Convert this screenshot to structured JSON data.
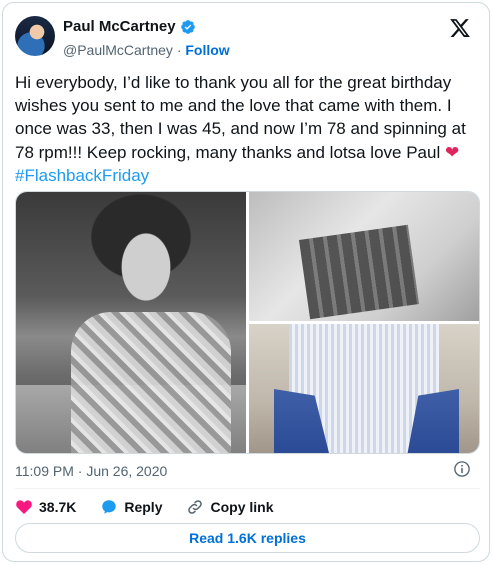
{
  "author": {
    "name": "Paul McCartney",
    "handle": "@PaulMcCartney",
    "separator": "·",
    "follow_label": "Follow"
  },
  "tweet": {
    "text_main": "Hi everybody, I’d like to thank you all for the great birthday wishes you sent to me and the love that came with them. I once was 33, then I was 45, and now I’m 78 and spinning at 78 rpm!!! Keep rocking, many thanks and lotsa love Paul ",
    "heart": "❤",
    "hashtag": "#FlashbackFriday",
    "timestamp": "11:09 PM · Jun 26, 2020"
  },
  "actions": {
    "like_count": "38.7K",
    "reply_label": "Reply",
    "copy_link_label": "Copy link"
  },
  "footer": {
    "read_replies_label": "Read 1.6K replies"
  },
  "colors": {
    "accent": "#1d9bf0",
    "link": "#006fd6",
    "like": "#f91880",
    "muted": "#536471"
  },
  "icons": [
    "verified-badge-icon",
    "x-logo-icon",
    "info-icon",
    "heart-icon",
    "reply-icon",
    "link-icon"
  ]
}
